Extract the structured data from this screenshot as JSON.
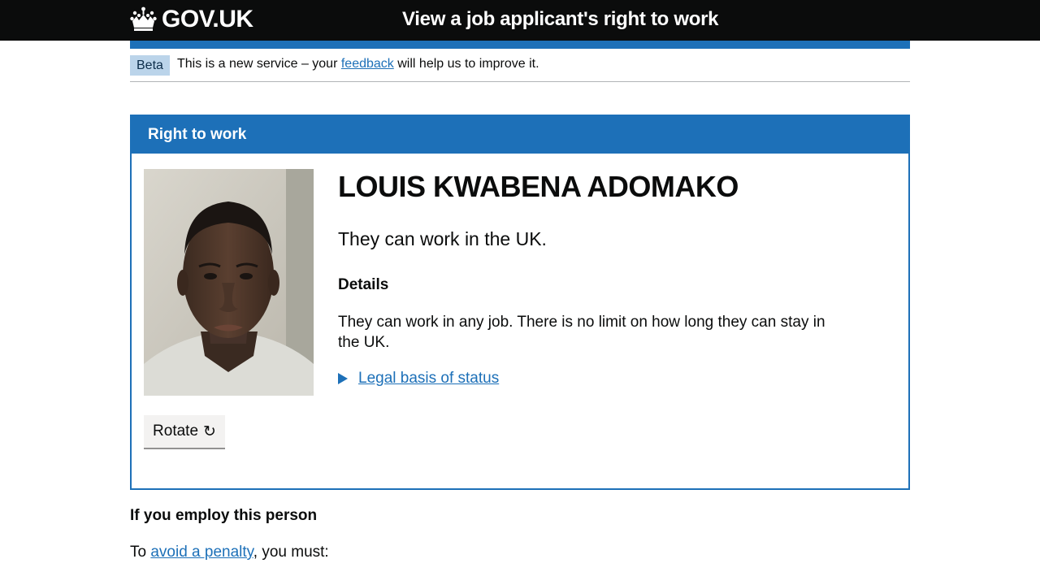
{
  "header": {
    "logo_text": "GOV.UK",
    "service_name": "View a job applicant's right to work"
  },
  "phase_banner": {
    "tag": "Beta",
    "text_before": "This is a new service – your",
    "link_text": "feedback",
    "text_after": "will help us to improve it."
  },
  "panel": {
    "title": "Right to work",
    "name": "LOUIS KWABENA ADOMAKO",
    "status": "They can work in the UK.",
    "details_heading": "Details",
    "details_text": "They can work in any job. There is no limit on how long they can stay in the UK.",
    "legal_link": "Legal basis of status",
    "rotate_label": "Rotate",
    "rotate_icon": "↻"
  },
  "employ": {
    "heading": "If you employ this person",
    "text_before": "To",
    "link_text": "avoid a penalty",
    "text_after": ", you must:"
  },
  "colors": {
    "header_bg": "#0b0c0c",
    "brand_blue": "#1d70b8",
    "tag_bg": "#bbd4ea",
    "button_bg": "#f3f2f1"
  },
  "icons": {
    "logo": "crown-icon",
    "rotate": "rotate-clockwise-icon",
    "disclosure": "triangle-right-icon"
  }
}
